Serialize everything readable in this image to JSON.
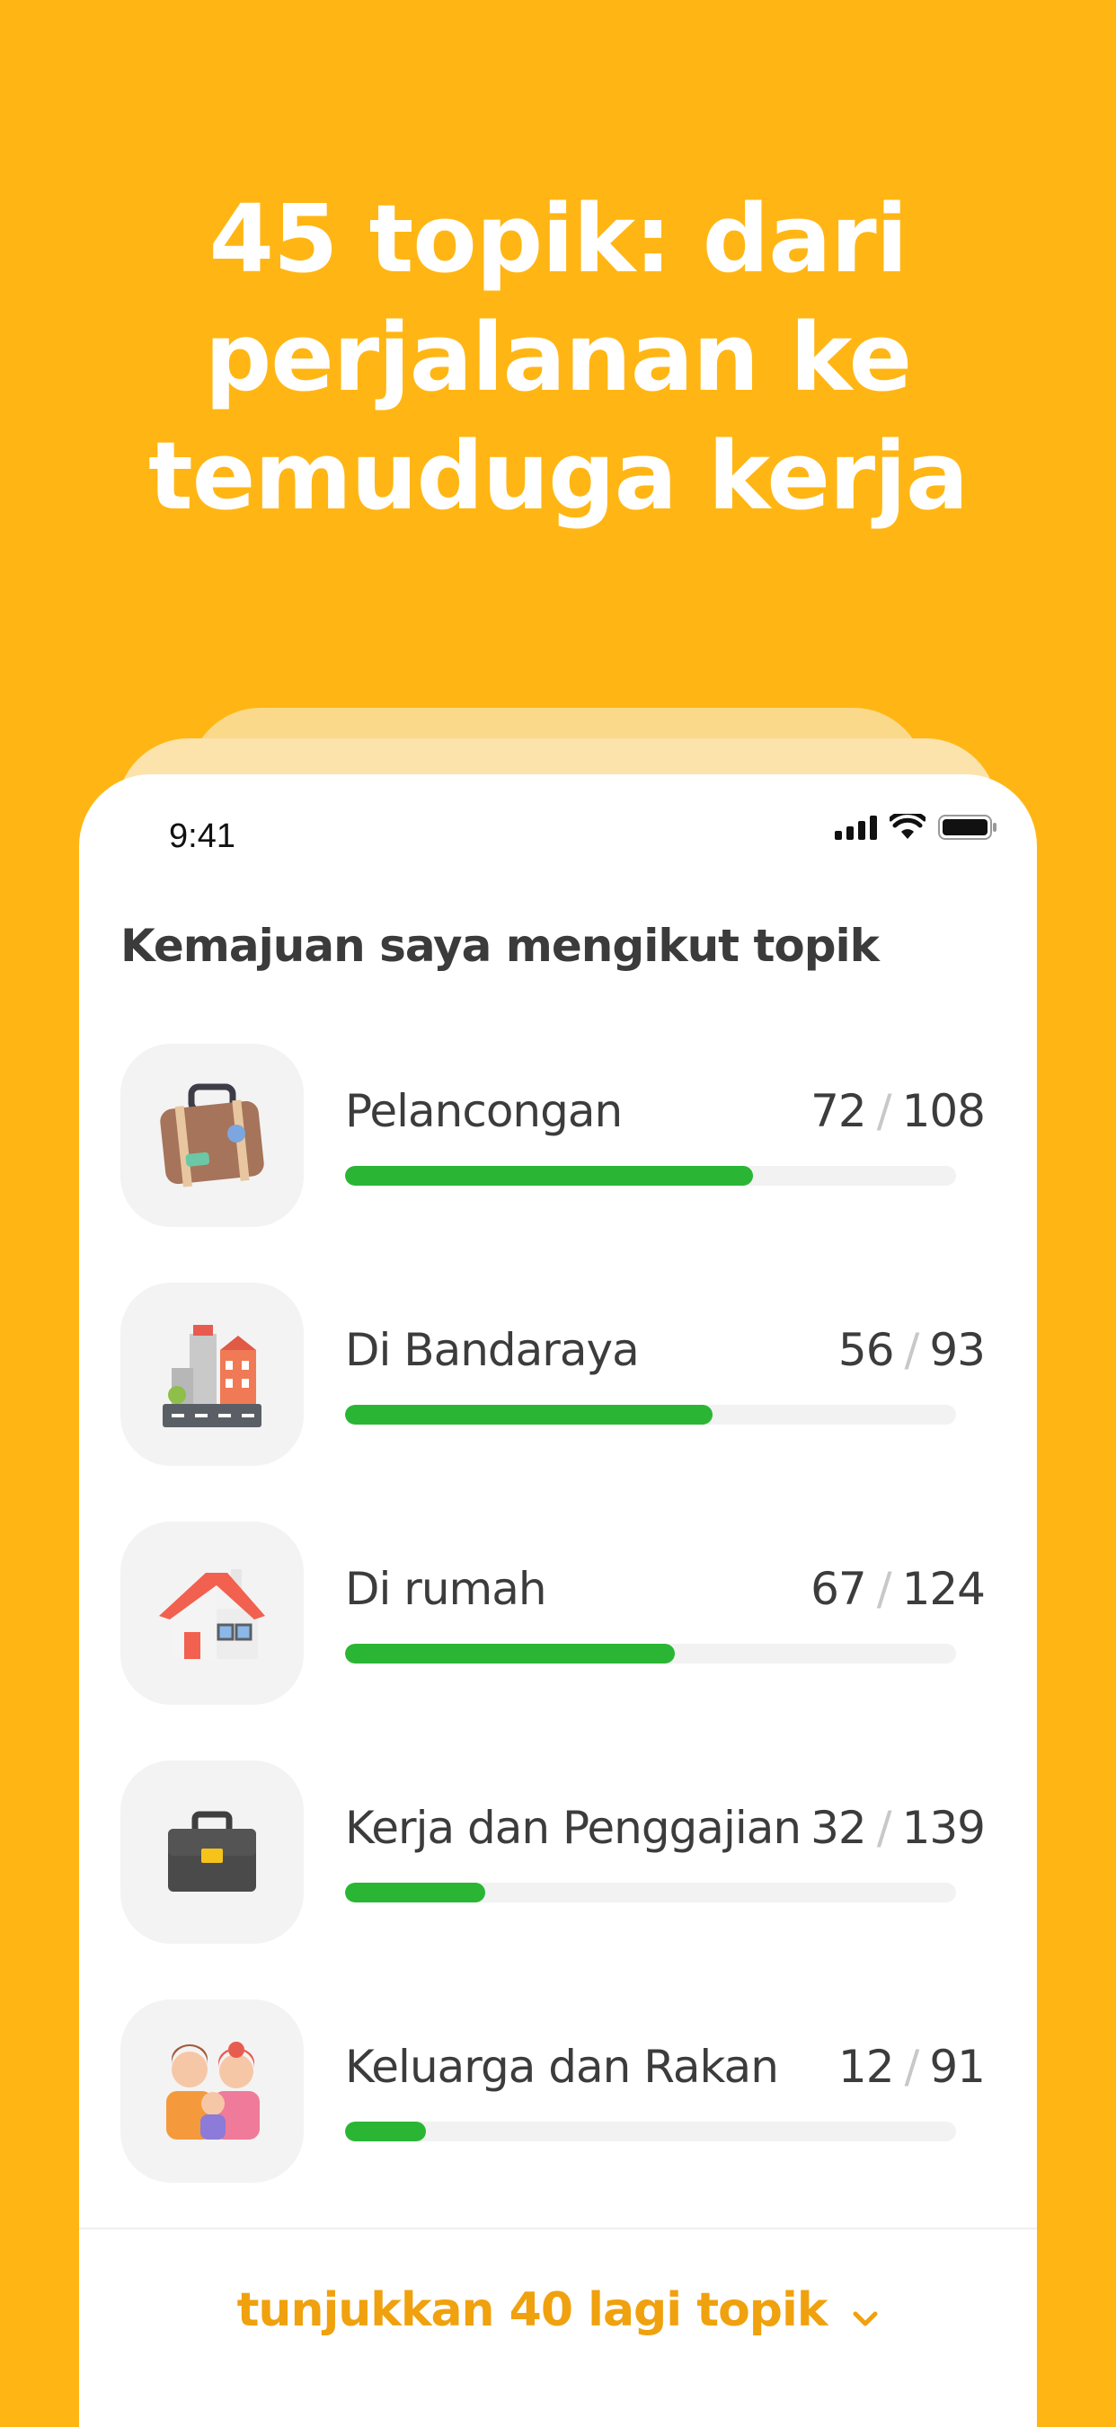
{
  "headline": {
    "line1": "45 topik: dari",
    "line2": "perjalanan ke",
    "line3": "temuduga kerja"
  },
  "status_bar": {
    "time": "9:41"
  },
  "section": {
    "title": "Kemajuan saya mengikut topik"
  },
  "topics": [
    {
      "name": "Pelancongan",
      "done": "72",
      "total": "108",
      "progress": 0.667,
      "icon": "suitcase-icon"
    },
    {
      "name": "Di Bandaraya",
      "done": "56",
      "total": "93",
      "progress": 0.602,
      "icon": "city-icon"
    },
    {
      "name": "Di rumah",
      "done": "67",
      "total": "124",
      "progress": 0.54,
      "icon": "house-icon"
    },
    {
      "name": "Kerja dan Penggajian",
      "done": "32",
      "total": "139",
      "progress": 0.23,
      "icon": "briefcase-icon"
    },
    {
      "name": "Keluarga dan Rakan",
      "done": "12",
      "total": "91",
      "progress": 0.132,
      "icon": "family-icon"
    }
  ],
  "show_more": {
    "label": "tunjukkan 40 lagi topik"
  },
  "colors": {
    "background": "#FFB614",
    "progress": "#2AB634",
    "accent": "#F0A10E"
  }
}
